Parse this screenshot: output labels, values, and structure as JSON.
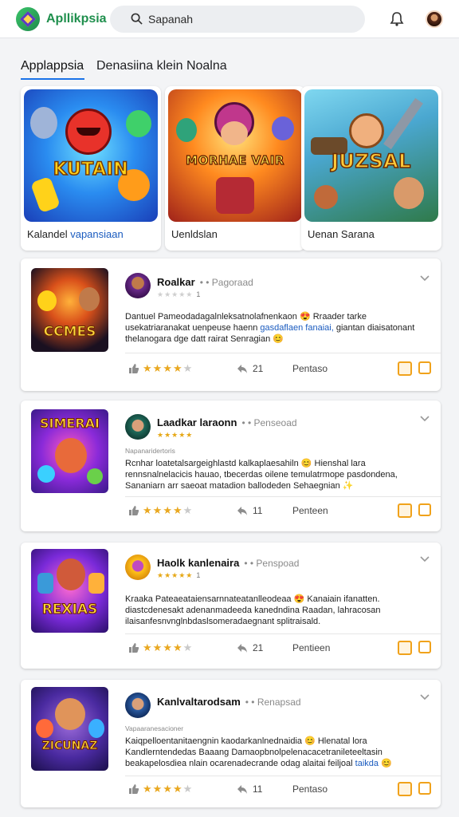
{
  "header": {
    "app_title": "Apllikpsia",
    "search_placeholder": "Sapanah",
    "icons": [
      "app-logo-icon",
      "search-icon",
      "bell-icon",
      "avatar"
    ]
  },
  "tabs": [
    {
      "label": "Applappsia",
      "active": true
    },
    {
      "label": "Denasiina klein  Noalna",
      "active": false
    }
  ],
  "featured": [
    {
      "art_word": "KUTAIN",
      "label_plain": "Kalandel ",
      "label_highlight": "vapansiaan"
    },
    {
      "art_word": "MORHAE VAIR",
      "label_plain": "Uenldslan",
      "label_highlight": ""
    },
    {
      "art_word": "JUZSAL",
      "label_plain": "Uenan Sarana",
      "label_highlight": ""
    }
  ],
  "reviews": [
    {
      "thumb_word": "CCMES",
      "name": "Roalkar",
      "tag": "• • Pagoraad",
      "stars_small": "★★★★★",
      "stars_small_num": "1",
      "subtitle": "",
      "body": [
        {
          "t": "Dantuel Pameodadagalnleksatnolafnenkaon ",
          "c": ""
        },
        {
          "t": "😍",
          "c": "emo"
        },
        {
          "t": " Rraader tarke usekatriaranakat uenpeuse haenn ",
          "c": ""
        },
        {
          "t": "gasdaflaen fanaiai,",
          "c": "hl"
        },
        {
          "t": " giantan diaisatonant thelanogara dge datt rairat Senragian ",
          "c": ""
        },
        {
          "t": "😊",
          "c": "emo"
        }
      ],
      "rating": 4,
      "replies": "21",
      "reply_label": "Pentaso"
    },
    {
      "thumb_word": "SIMERAI",
      "name": "Laadkar laraonn",
      "tag": "• • Penseoad",
      "stars_small": "★★★★★",
      "stars_small_num": "",
      "subtitle": "Napanaridertoris",
      "body": [
        {
          "t": "Rcnhar loatetalsargeighlastd kalkaplaesahiln ",
          "c": ""
        },
        {
          "t": "😊",
          "c": "emo"
        },
        {
          "t": " Hienshal lara rennsnalnelacicis hauao, tbecerdas oilene temulatrmope pasdondena, Sananiarn arr saeoat matadion ballodeden Sehaegnian ",
          "c": ""
        },
        {
          "t": "✨",
          "c": "emo"
        }
      ],
      "rating": 4,
      "replies": "11",
      "reply_label": "Penteen"
    },
    {
      "thumb_word": "REXIAS",
      "name": "Haolk kanlenaira",
      "tag": "• • Penspoad",
      "stars_small": "★★★★★",
      "stars_small_num": "1",
      "subtitle": "",
      "body": [
        {
          "t": "Kraaka Pateaeataiensarnnateatanlleodeaa ",
          "c": ""
        },
        {
          "t": "😍",
          "c": "emo"
        },
        {
          "t": " Kanaiain ifanatten. diastcdenesakt adenanmadeeda kanedndina Raadan, lahracosan ilaisanfesnvnglnbdaslsomeradaegnant splitraisald.",
          "c": ""
        }
      ],
      "rating": 4,
      "replies": "21",
      "reply_label": "Pentieen"
    },
    {
      "thumb_word": "ZICUNAZ",
      "name": "Kanlvaltarodsam",
      "tag": "• • Renapsad",
      "stars_small": "",
      "stars_small_num": "",
      "subtitle": "Vapaaranesacioner",
      "body": [
        {
          "t": "Kaiqpelloentanitaengnin kaodarkanlnednaidia ",
          "c": ""
        },
        {
          "t": "😊",
          "c": "emo"
        },
        {
          "t": " Hlenatal lora Kandlerntendedas Baaang Damaopbnolpelenacacetranileteeltasin beakapelosdiea nlain ocarenadecrande odag alaitai feiljoal ",
          "c": ""
        },
        {
          "t": "taikda",
          "c": "hl"
        },
        {
          "t": " ",
          "c": ""
        },
        {
          "t": "😊",
          "c": "emo"
        }
      ],
      "rating": 4,
      "replies": "11",
      "reply_label": "Pentaso"
    }
  ],
  "colors": {
    "accent": "#1a73e8",
    "brand_green": "#1f8f4d",
    "star": "#e9a821",
    "action_orange": "#f0a21b",
    "background": "#f3f4f6"
  }
}
